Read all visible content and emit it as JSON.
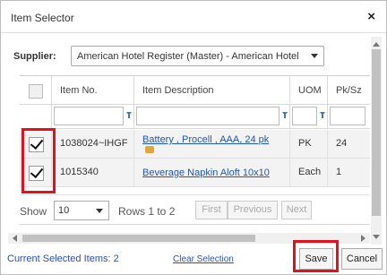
{
  "dialog": {
    "title": "Item Selector",
    "close_symbol": "×"
  },
  "supplier": {
    "label": "Supplier:",
    "value": "American Hotel Register (Master) - American Hotel"
  },
  "grid": {
    "columns": [
      "",
      "Item No.",
      "Item Description",
      "UOM",
      "Pk/Sz"
    ],
    "rows": [
      {
        "checked": true,
        "item_no": "1038024~IHGF",
        "description": "Battery , Procell , AAA, 24 pk",
        "uom": "PK",
        "pk_sz": "24",
        "has_image": true
      },
      {
        "checked": true,
        "item_no": "1015340",
        "description": "Beverage Napkin Aloft 10x10",
        "uom": "Each",
        "pk_sz": "1",
        "has_image": false
      }
    ]
  },
  "pager": {
    "show_label": "Show",
    "page_size": "10",
    "rows_text": "Rows 1 to 2",
    "first": "First",
    "previous": "Previous",
    "next": "Next"
  },
  "footer": {
    "selected_text": "Current Selected Items: 2",
    "clear_selection": "Clear Selection",
    "save": "Save",
    "cancel": "Cancel"
  },
  "icons": {
    "close": "close-icon",
    "filter": "filter-icon",
    "image": "image-icon",
    "dropdown": "chevron-down-icon"
  },
  "colors": {
    "highlight": "#e3101e",
    "link": "#1f55b3",
    "filter_icon": "#3a78c2"
  }
}
